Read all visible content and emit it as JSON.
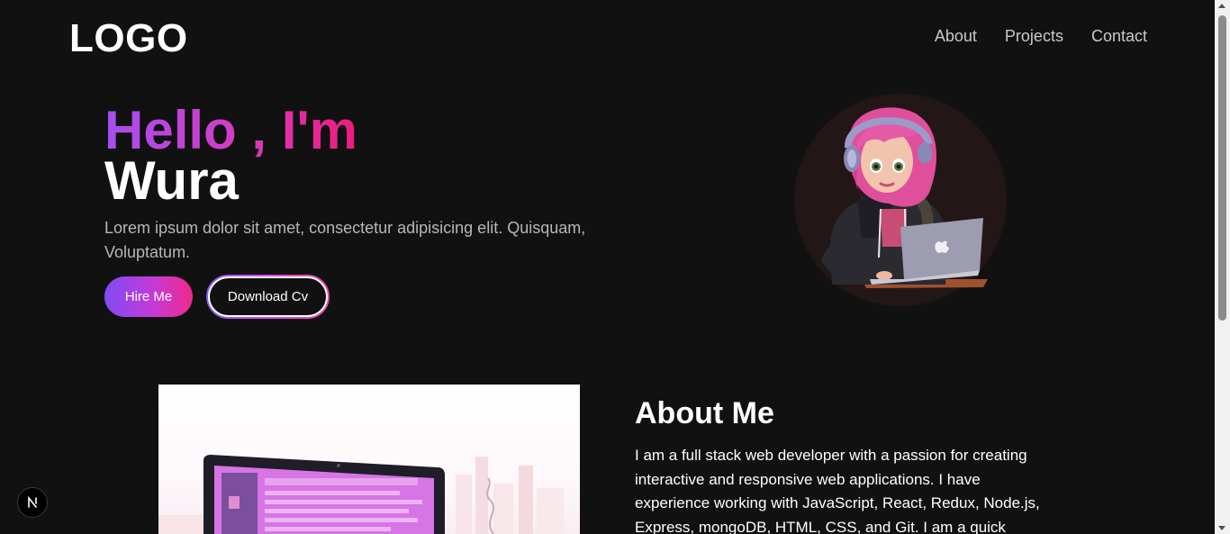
{
  "header": {
    "logo": "LOGO",
    "nav": [
      "About",
      "Projects",
      "Contact"
    ]
  },
  "hero": {
    "greeting": "Hello , I'm",
    "name": "Wura",
    "intro": "Lorem ipsum dolor sit amet, consectetur adipisicing elit. Quisquam, Voluptatum.",
    "hire_label": "Hire Me",
    "cv_label": "Download Cv"
  },
  "about": {
    "title": "About Me",
    "text": "I am a full stack web developer with a passion for creating interactive and responsive web applications. I have experience working with JavaScript, React, Redux, Node.js, Express, mongoDB, HTML, CSS, and Git. I am a quick"
  },
  "badge": {
    "letter": "N"
  },
  "colors": {
    "background": "#111111",
    "accent_purple": "#a64ef0",
    "accent_pink": "#ee1b7d",
    "avatar_circle": "#231616"
  },
  "icons": [
    "avatar-illustration",
    "laptop-illustration",
    "nextjs-icon"
  ]
}
